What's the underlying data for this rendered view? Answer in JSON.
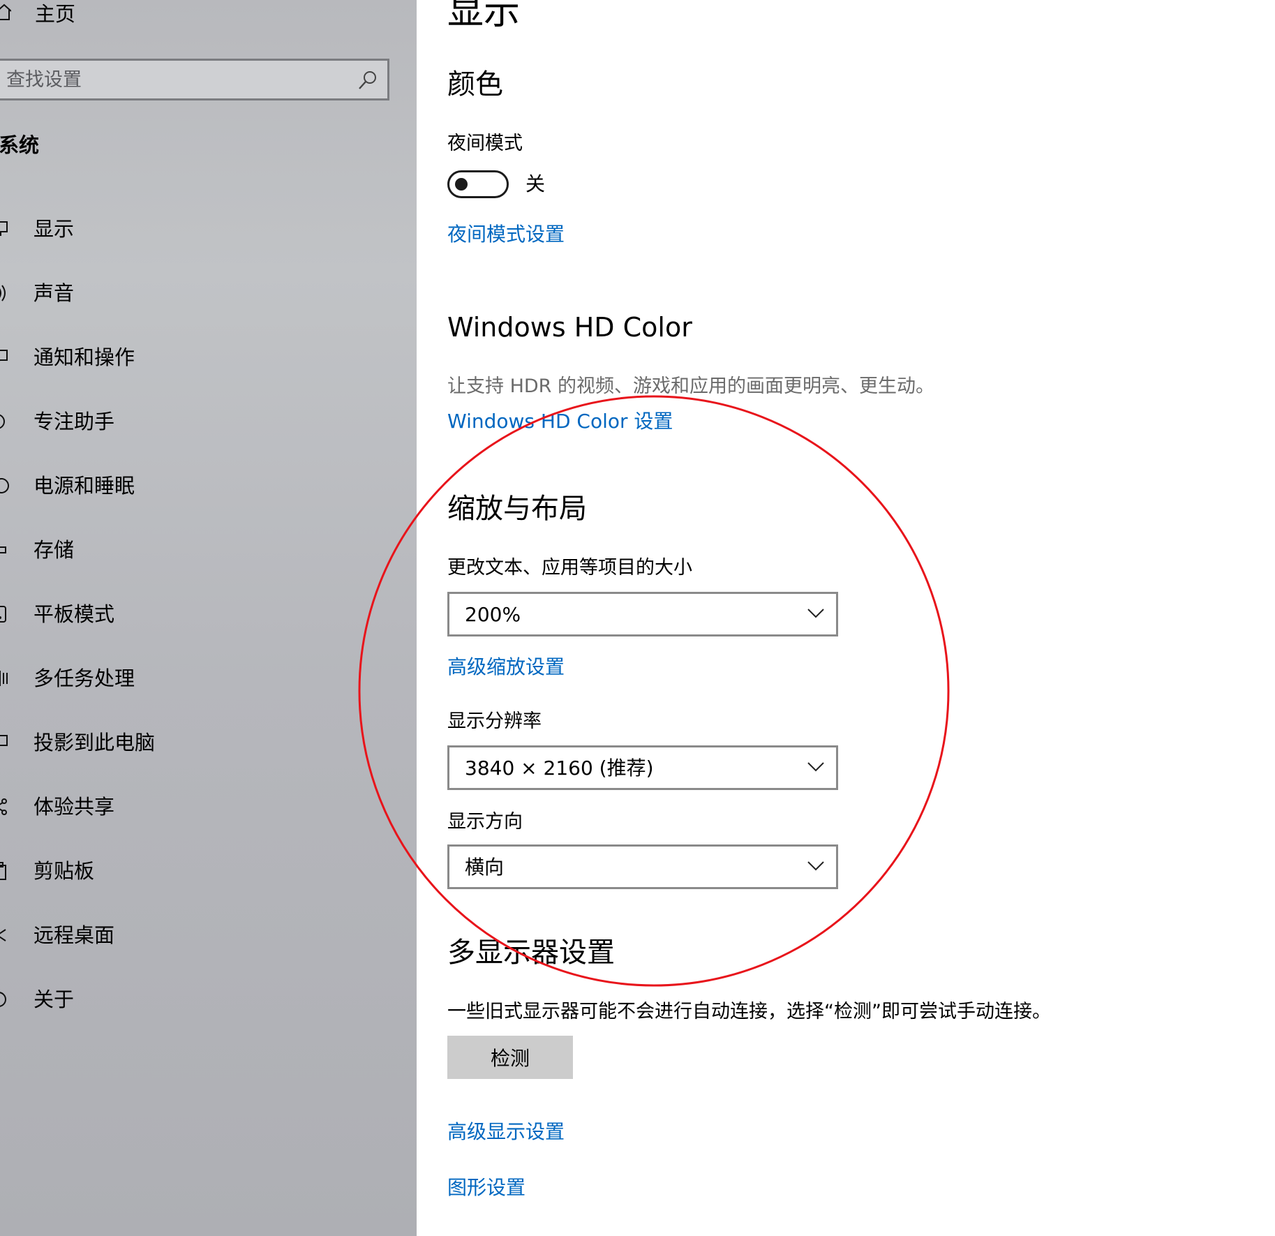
{
  "sidebar": {
    "home_label": "主页",
    "search_placeholder": "查找设置",
    "section_title": "系统",
    "items": [
      {
        "label": "显示",
        "icon": "monitor-icon"
      },
      {
        "label": "声音",
        "icon": "speaker-icon"
      },
      {
        "label": "通知和操作",
        "icon": "notification-icon"
      },
      {
        "label": "专注助手",
        "icon": "moon-icon"
      },
      {
        "label": "电源和睡眠",
        "icon": "power-icon"
      },
      {
        "label": "存储",
        "icon": "storage-icon"
      },
      {
        "label": "平板模式",
        "icon": "tablet-icon"
      },
      {
        "label": "多任务处理",
        "icon": "multitask-icon"
      },
      {
        "label": "投影到此电脑",
        "icon": "project-icon"
      },
      {
        "label": "体验共享",
        "icon": "share-icon"
      },
      {
        "label": "剪贴板",
        "icon": "clipboard-icon"
      },
      {
        "label": "远程桌面",
        "icon": "remote-desktop-icon"
      },
      {
        "label": "关于",
        "icon": "info-icon"
      }
    ]
  },
  "main": {
    "page_title": "显示",
    "color": {
      "heading": "颜色",
      "night_mode_label": "夜间模式",
      "night_mode_state": "关",
      "night_mode_link": "夜间模式设置"
    },
    "hdr": {
      "heading": "Windows HD Color",
      "description": "让支持 HDR 的视频、游戏和应用的画面更明亮、更生动。",
      "link": "Windows HD Color 设置"
    },
    "scale": {
      "heading": "缩放与布局",
      "size_label": "更改文本、应用等项目的大小",
      "size_value": "200%",
      "advanced_link": "高级缩放设置",
      "resolution_label": "显示分辨率",
      "resolution_value": "3840 × 2160 (推荐)",
      "orientation_label": "显示方向",
      "orientation_value": "横向"
    },
    "multi": {
      "heading": "多显示器设置",
      "description": "一些旧式显示器可能不会进行自动连接，选择“检测”即可尝试手动连接。",
      "detect_button": "检测",
      "advanced_display_link": "高级显示设置",
      "graphics_link": "图形设置"
    }
  },
  "colors": {
    "link": "#0067c0",
    "annotation_circle": "#e8141b",
    "sidebar_bg": "#b8b9bd"
  }
}
